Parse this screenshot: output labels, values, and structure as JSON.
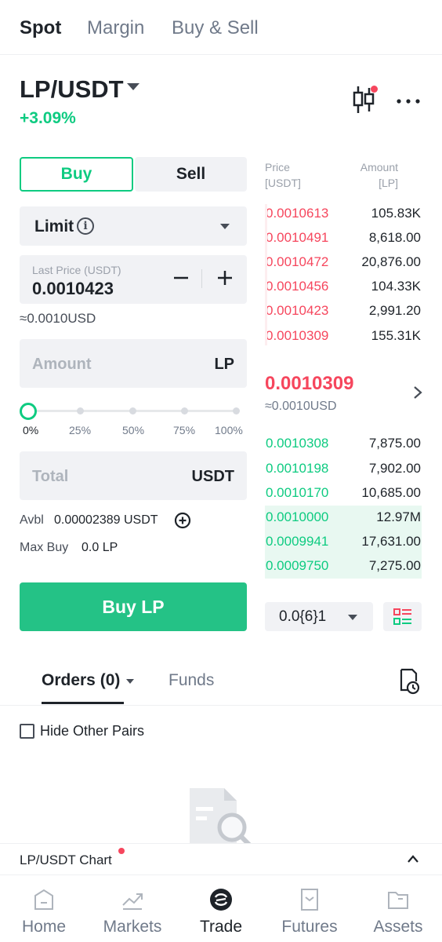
{
  "top_tabs": [
    {
      "label": "Spot",
      "active": true
    },
    {
      "label": "Margin",
      "active": false
    },
    {
      "label": "Buy & Sell",
      "active": false
    }
  ],
  "pair": {
    "symbol": "LP/USDT",
    "change": "+3.09%"
  },
  "trade_form": {
    "buy_label": "Buy",
    "sell_label": "Sell",
    "order_type": "Limit",
    "info_glyph": "i",
    "price_label": "Last Price (USDT)",
    "price_value": "0.0010423",
    "price_usd": "≈0.0010USD",
    "amount_placeholder": "Amount",
    "amount_unit": "LP",
    "slider_labels": [
      "0%",
      "25%",
      "50%",
      "75%",
      "100%"
    ],
    "slider_value_percent": 0,
    "total_placeholder": "Total",
    "total_unit": "USDT",
    "avbl_label": "Avbl",
    "avbl_value": "0.00002389 USDT",
    "max_buy_label": "Max Buy",
    "max_buy_value": "0.0 LP",
    "submit_label": "Buy LP"
  },
  "order_book": {
    "price_header": "Price",
    "price_header_unit": "[USDT]",
    "amount_header": "Amount",
    "amount_header_unit": "[LP]",
    "asks": [
      {
        "price": "0.0010613",
        "amount": "105.83K"
      },
      {
        "price": "0.0010491",
        "amount": "8,618.00"
      },
      {
        "price": "0.0010472",
        "amount": "20,876.00"
      },
      {
        "price": "0.0010456",
        "amount": "104.33K"
      },
      {
        "price": "0.0010423",
        "amount": "2,991.20"
      },
      {
        "price": "0.0010309",
        "amount": "155.31K"
      }
    ],
    "last_price": "0.0010309",
    "last_price_usd": "≈0.0010USD",
    "bids": [
      {
        "price": "0.0010308",
        "amount": "7,875.00",
        "depth": 0
      },
      {
        "price": "0.0010198",
        "amount": "7,902.00",
        "depth": 0
      },
      {
        "price": "0.0010170",
        "amount": "10,685.00",
        "depth": 0
      },
      {
        "price": "0.0010000",
        "amount": "12.97M",
        "depth": 1
      },
      {
        "price": "0.0009941",
        "amount": "17,631.00",
        "depth": 1
      },
      {
        "price": "0.0009750",
        "amount": "7,275.00",
        "depth": 1
      }
    ],
    "precision": "0.0{6}1"
  },
  "orders": {
    "orders_tab": "Orders (0)",
    "funds_tab": "Funds",
    "hide_other_pairs": "Hide Other Pairs"
  },
  "chart_bar": {
    "label": "LP/USDT Chart"
  },
  "bottom_nav": [
    {
      "label": "Home",
      "icon": "home-icon",
      "active": false
    },
    {
      "label": "Markets",
      "icon": "markets-icon",
      "active": false
    },
    {
      "label": "Trade",
      "icon": "trade-icon",
      "active": true
    },
    {
      "label": "Futures",
      "icon": "futures-icon",
      "active": false
    },
    {
      "label": "Assets",
      "icon": "assets-icon",
      "active": false
    }
  ],
  "colors": {
    "up_green": "#0ecb81",
    "down_red": "#f6465d",
    "buy_button": "#24c286"
  }
}
